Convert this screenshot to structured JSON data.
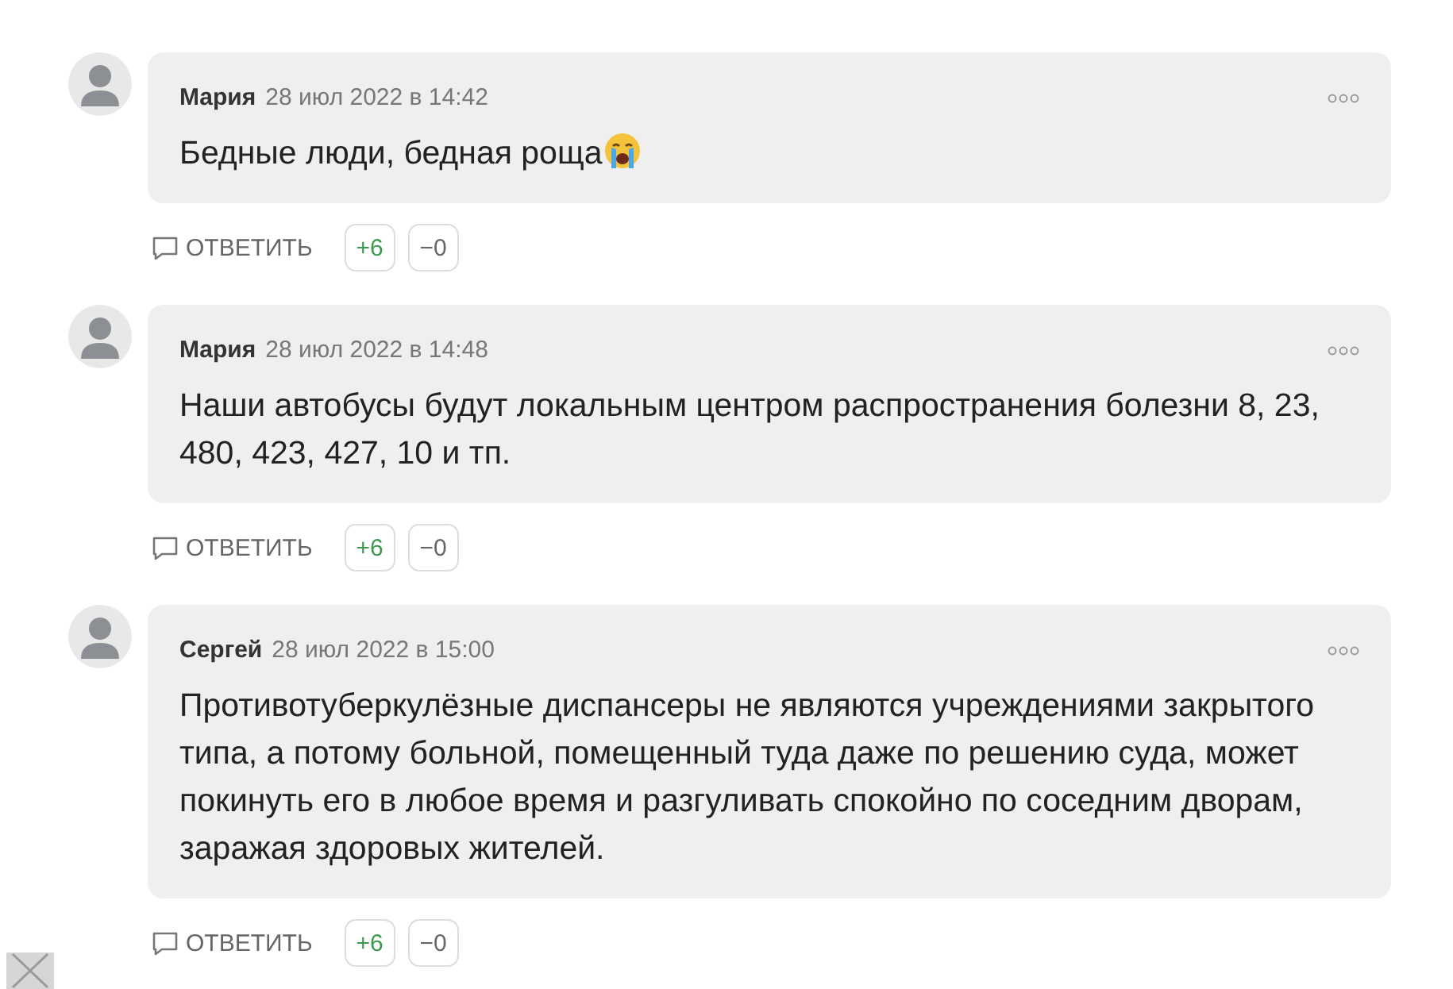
{
  "comments": [
    {
      "author": "Мария",
      "date": "28 июл 2022 в 14:42",
      "text": "Бедные люди, бедная роща",
      "trailing_emoji": true,
      "reply": "ОТВЕТИТЬ",
      "plus": "+6",
      "minus": "−0"
    },
    {
      "author": "Мария",
      "date": "28 июл 2022 в 14:48",
      "text": "Наши автобусы будут локальным центром распространения болезни 8, 23, 480, 423, 427, 10 и тп.",
      "trailing_emoji": false,
      "reply": "ОТВЕТИТЬ",
      "plus": "+6",
      "minus": "−0"
    },
    {
      "author": "Сергей",
      "date": "28 июл 2022 в 15:00",
      "text": "Противотуберкулёзные диспансеры не являются учреждениями закрытого типа, а потому больной, помещенный туда даже по решению суда, может покинуть его в любое время и разгуливать спокойно по соседним дворам, заражая здоровых жителей.",
      "trailing_emoji": false,
      "reply": "ОТВЕТИТЬ",
      "plus": "+6",
      "minus": "−0"
    }
  ]
}
